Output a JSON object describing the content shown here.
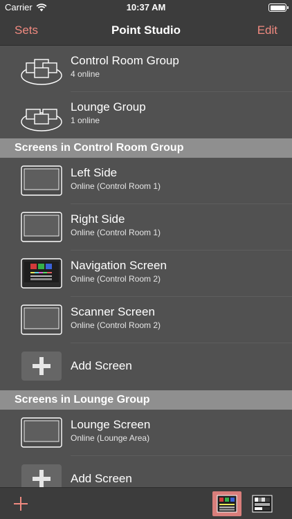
{
  "status_bar": {
    "carrier": "Carrier",
    "time": "10:37 AM"
  },
  "nav": {
    "left_label": "Sets",
    "title": "Point Studio",
    "right_label": "Edit"
  },
  "groups": [
    {
      "title": "Control Room Group",
      "subtitle": "4 online",
      "icon": "screen-group-icon"
    },
    {
      "title": "Lounge Group",
      "subtitle": "1 online",
      "icon": "screen-group-icon"
    }
  ],
  "sections": [
    {
      "header": "Screens in Control Room Group",
      "screens": [
        {
          "title": "Left Side",
          "subtitle": "Online (Control Room 1)",
          "icon": "monitor-icon"
        },
        {
          "title": "Right Side",
          "subtitle": "Online (Control Room 1)",
          "icon": "monitor-icon"
        },
        {
          "title": "Navigation Screen",
          "subtitle": "Online (Control Room 2)",
          "icon": "monitor-test-pattern-icon"
        },
        {
          "title": "Scanner Screen",
          "subtitle": "Online (Control Room 2)",
          "icon": "monitor-icon"
        }
      ],
      "add_label": "Add Screen"
    },
    {
      "header": "Screens in Lounge Group",
      "screens": [
        {
          "title": "Lounge Screen",
          "subtitle": "Online (Lounge Area)",
          "icon": "monitor-icon"
        }
      ],
      "add_label": "Add Screen"
    }
  ],
  "toolbar": {
    "add_icon": "plus-icon",
    "active_tool": "color-bars-icon",
    "other_tool": "grayscale-bars-icon"
  },
  "colors": {
    "accent": "#f08a80",
    "bar_bg": "#3c3c3c",
    "list_bg": "#515151",
    "section_bg": "#8f8f8f",
    "active_tool_bg": "#d97e7b"
  }
}
